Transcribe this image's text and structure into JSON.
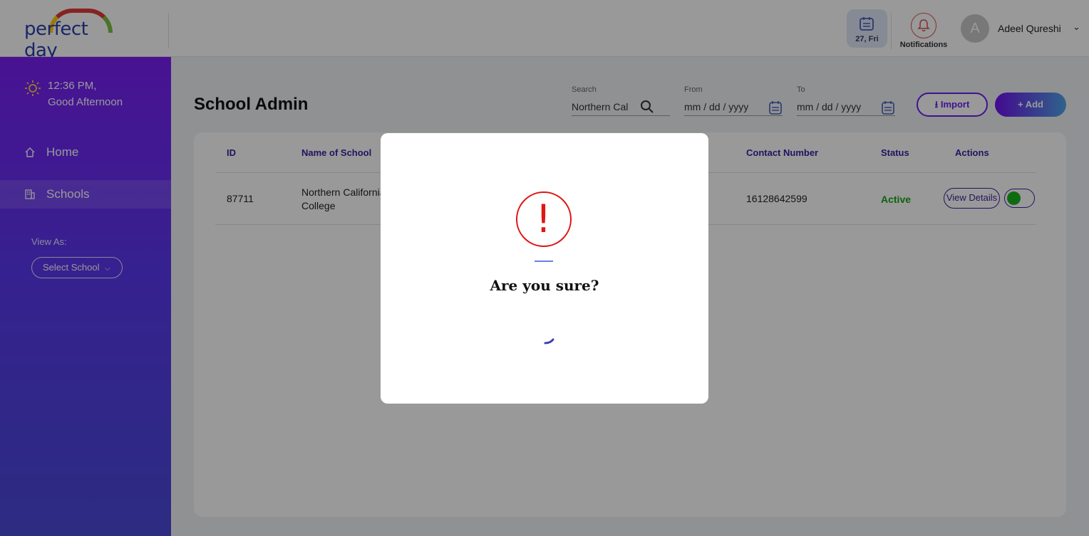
{
  "header": {
    "logo_text": "perfect day",
    "date_label": "27, Fri",
    "notifications_label": "Notifications",
    "avatar_initial": "A",
    "user_name": "Adeel Qureshi"
  },
  "sidebar": {
    "time": "12:36 PM,",
    "greeting": "Good Afternoon",
    "items": [
      {
        "label": "Home",
        "icon": "home-icon"
      },
      {
        "label": "Schools",
        "icon": "building-icon"
      }
    ],
    "view_as_label": "View As:",
    "select_school_label": "Select School"
  },
  "main": {
    "title": "School Admin",
    "search": {
      "label": "Search",
      "value": "Northern Cal"
    },
    "from": {
      "label": "From",
      "value": "mm / dd / yyyy"
    },
    "to": {
      "label": "To",
      "value": "mm / dd / yyyy"
    },
    "import_label": "Import",
    "add_label": "+ Add",
    "table": {
      "columns": [
        "ID",
        "Name of School",
        "Contact Number",
        "Status",
        "Actions"
      ],
      "rows": [
        {
          "id": "87711",
          "name_line1": "Northern California",
          "name_line2": "College",
          "contact": "16128642599",
          "status": "Active",
          "action_label": "View Details"
        }
      ]
    }
  },
  "modal": {
    "icon": "warning-icon",
    "icon_mark": "!",
    "title": "Are you sure?"
  },
  "colors": {
    "accent": "#6a1ff0",
    "status_active": "#16a316",
    "warning": "#e01515"
  }
}
